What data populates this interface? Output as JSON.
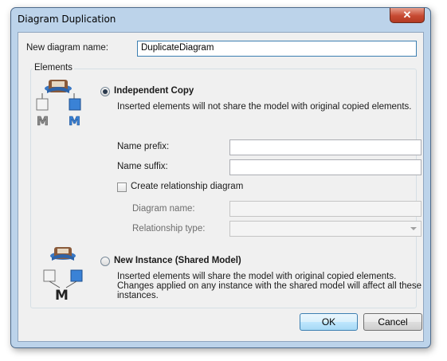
{
  "window": {
    "title": "Diagram Duplication",
    "close_glyph": "✕"
  },
  "new_diagram": {
    "label": "New diagram name:",
    "value": "DuplicateDiagram"
  },
  "elements_group": {
    "label": "Elements"
  },
  "independent_copy": {
    "label": "Independent Copy",
    "description": "Inserted elements will not share the model with original copied elements.",
    "icon": "independent-copy-icon",
    "icon_letters": [
      "M",
      "M"
    ],
    "name_prefix": {
      "label": "Name prefix:",
      "value": ""
    },
    "name_suffix": {
      "label": "Name suffix:",
      "value": ""
    },
    "create_relationship": {
      "label": "Create relationship diagram",
      "checked": false
    },
    "diagram_name": {
      "label": "Diagram name:",
      "value": ""
    },
    "relationship_type": {
      "label": "Relationship type:",
      "value": ""
    }
  },
  "new_instance": {
    "label": "New Instance (Shared Model)",
    "description_lines": [
      "Inserted elements will share the model with original copied elements.",
      "Changes applied on any instance with the shared model will affect all these",
      "instances."
    ],
    "icon": "shared-model-icon",
    "icon_letter": "M"
  },
  "buttons": {
    "ok": "OK",
    "cancel": "Cancel"
  },
  "colors": {
    "accent": "#3c7fb1",
    "title_bar": "#bcd3ea",
    "close_button": "#c74a32"
  }
}
